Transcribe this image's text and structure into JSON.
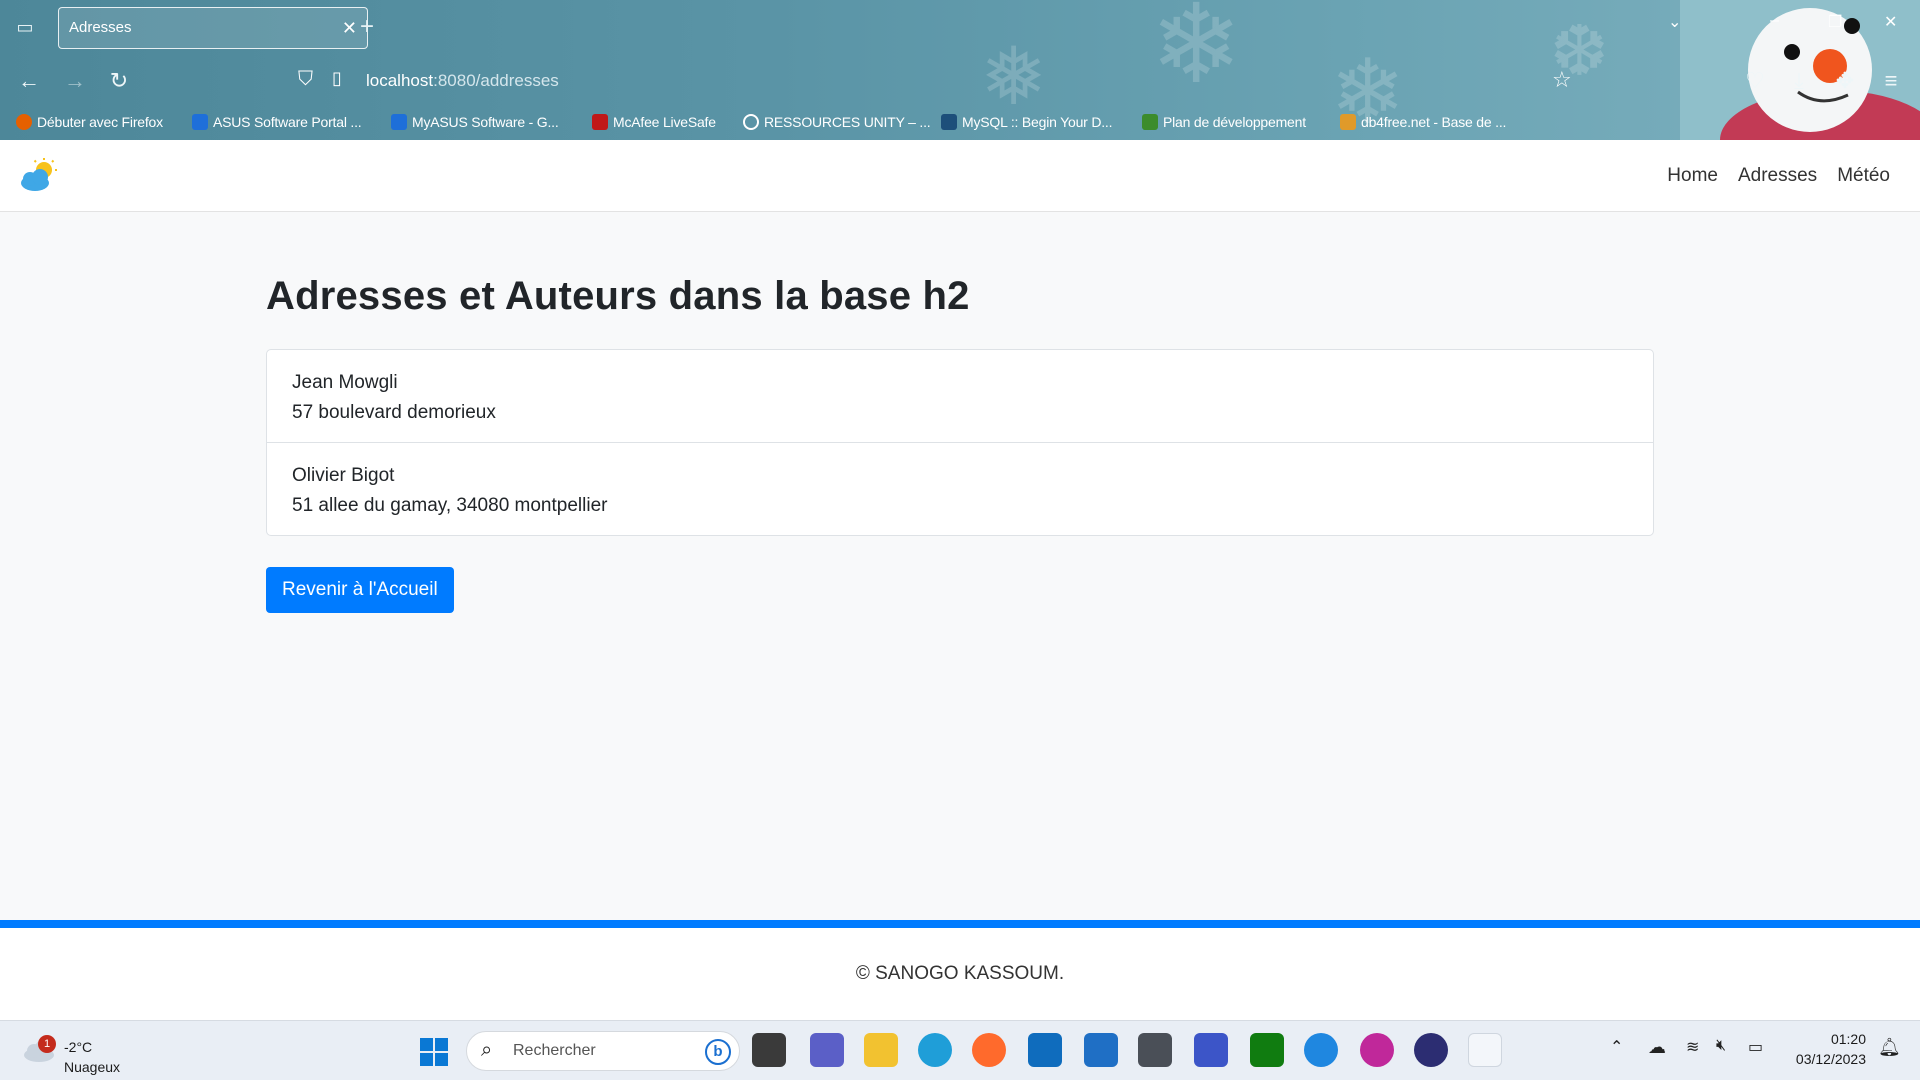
{
  "browser": {
    "tab_title": "Adresses",
    "url_host": "localhost",
    "url_rest": ":8080/addresses",
    "bookmarks": [
      "Débuter avec Firefox",
      "ASUS Software Portal ...",
      "MyASUS Software - G...",
      "McAfee LiveSafe",
      "RESSOURCES UNITY – ...",
      "MySQL :: Begin Your D...",
      "Plan de développement",
      "db4free.net - Base de ..."
    ]
  },
  "nav": {
    "links": [
      "Home",
      "Adresses",
      "Météo"
    ]
  },
  "main": {
    "title": "Adresses et Auteurs dans la base h2",
    "entries": [
      {
        "name": "Jean Mowgli",
        "address": "57 boulevard demorieux"
      },
      {
        "name": "Olivier Bigot",
        "address": "51 allee du gamay, 34080 montpellier"
      }
    ],
    "home_button": "Revenir à l'Accueil"
  },
  "footer": {
    "text": "© SANOGO KASSOUM."
  },
  "taskbar": {
    "weather_badge": "1",
    "temperature": "-2°C",
    "condition": "Nuageux",
    "search_placeholder": "Rechercher",
    "time": "01:20",
    "date": "03/12/2023"
  },
  "colors": {
    "primary": "#007bff",
    "chrome": "#5a94a6"
  }
}
